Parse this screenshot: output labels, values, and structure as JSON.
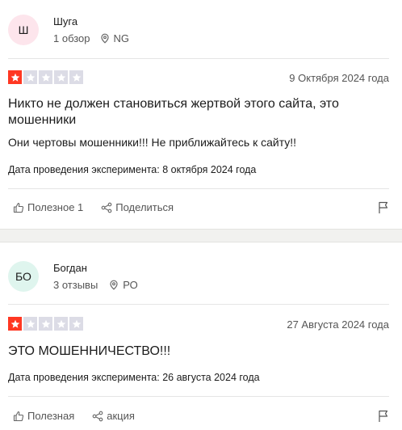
{
  "reviews": [
    {
      "avatar_initials": "Ш",
      "avatar_color": "#fde5ec",
      "author": "Шуга",
      "reviews_count": "1 обзор",
      "country": "NG",
      "rating": 1,
      "date": "9 Октября 2024 года",
      "title": "Никто не должен становиться жертвой этого сайта, это мошенники",
      "body": "Они чертовы мошенники!!! Не приближайтесь к сайту!!",
      "experience_date": "Дата проведения эксперимента: 8 октября 2024 года",
      "useful_label": "Полезное 1",
      "share_label": "Поделиться"
    },
    {
      "avatar_initials": "БО",
      "avatar_color": "#dff5ee",
      "author": "Богдан",
      "reviews_count": "3 отзывы",
      "country": "РО",
      "rating": 1,
      "date": "27 Августа 2024 года",
      "title": "ЭТО МОШЕННИЧЕСТВО!!!",
      "body": "",
      "experience_date": "Дата проведения эксперимента: 26 августа 2024 года",
      "useful_label": "Полезная",
      "share_label": "акция"
    }
  ],
  "colors": {
    "star_on": "#ff3722",
    "star_off": "#dcdce6"
  }
}
